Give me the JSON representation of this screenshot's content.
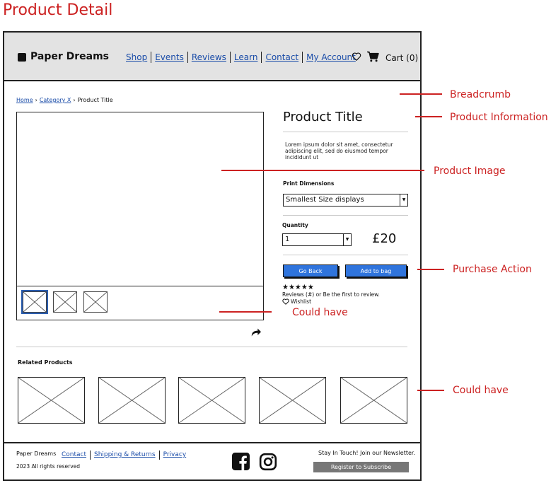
{
  "page_title": "Product Detail",
  "header": {
    "brand": "Paper Dreams",
    "nav": [
      "Shop",
      "Events",
      "Reviews",
      "Learn",
      "Contact",
      "My Account"
    ],
    "cart_label": "Cart (0)"
  },
  "breadcrumb": {
    "items": [
      "Home",
      "Category X",
      "Product Title"
    ],
    "separator": "›"
  },
  "product": {
    "title": "Product Title",
    "description": "Lorem ipsum dolor sit amet, consectetur adipiscing elit, sed do eiusmod tempor incididunt ut",
    "dimensions_label": "Print Dimensions",
    "dimensions_value": "Smallest Size displays",
    "quantity_label": "Quantity",
    "quantity_value": "1",
    "price": "£20",
    "go_back_label": "Go Back",
    "add_to_bag_label": "Add to bag",
    "rating_stars": "★★★★★",
    "reviews_text": "Reviews (#) or Be the first to review.",
    "wishlist_label": "Wishlist"
  },
  "related": {
    "title": "Related Products",
    "count": 5
  },
  "footer": {
    "brand": "Paper Dreams",
    "links": [
      "Contact",
      "Shipping & Returns",
      "Privacy"
    ],
    "copyright": "2023 All rights reserved",
    "newsletter_text": "Stay In Touch! Join our Newsletter.",
    "subscribe_label": "Register to Subscribe"
  },
  "annotations": {
    "breadcrumb": "Breadcrumb",
    "product_information": "Product Information",
    "product_image": "Product Image",
    "purchase_action": "Purchase Action",
    "could_have_1": "Could have",
    "could_have_2": "Could have"
  },
  "colors": {
    "annotation": "#cc2222",
    "link": "#1a4ca8",
    "button": "#2f74dd",
    "header_bg": "#e3e3e3"
  },
  "icons": [
    "heart-icon",
    "cart-icon",
    "share-icon",
    "facebook-icon",
    "instagram-icon"
  ]
}
